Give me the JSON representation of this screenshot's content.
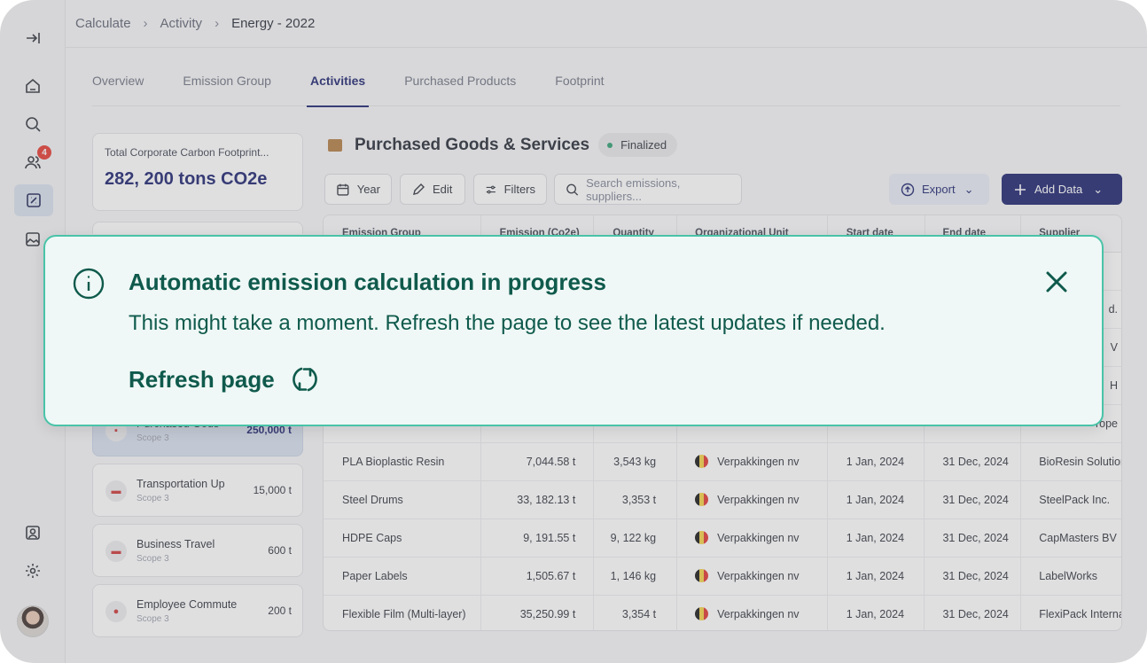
{
  "breadcrumb": {
    "items": [
      "Calculate",
      "Activity"
    ],
    "current": "Energy - 2022"
  },
  "sidebar": {
    "notification_count": "4"
  },
  "tabs": [
    "Overview",
    "Emission Group",
    "Activities",
    "Purchased Products",
    "Footprint"
  ],
  "total": {
    "label": "Total Corporate Carbon Footprint...",
    "value": "282, 200 tons CO2e"
  },
  "categories": [
    {
      "name": "Purchased Gods",
      "scope": "Scope 3",
      "value": "250,000 t"
    },
    {
      "name": "Transportation Up",
      "scope": "Scope 3",
      "value": "15,000 t"
    },
    {
      "name": "Business Travel",
      "scope": "Scope 3",
      "value": "600 t"
    },
    {
      "name": "Employee Commute",
      "scope": "Scope 3",
      "value": "200 t"
    }
  ],
  "content": {
    "title": "Purchased Goods & Services",
    "status": "Finalized"
  },
  "toolbar": {
    "year": "Year",
    "edit": "Edit",
    "filters": "Filters",
    "search_placeholder": "Search emissions, suppliers...",
    "export": "Export",
    "add": "Add Data"
  },
  "table": {
    "headers": [
      "Emission Group",
      "Emission (Co2e)",
      "Quantity",
      "Organizational Unit",
      "Start date",
      "End date",
      "Supplier"
    ],
    "rows": [
      [
        "PLA Bioplastic Resin",
        "7,044.58 t",
        "3,543 kg",
        "Verpakkingen nv",
        "1 Jan, 2024",
        "31 Dec, 2024",
        "BioResin Solutions"
      ],
      [
        "Steel Drums",
        "33, 182.13 t",
        "3,353 t",
        "Verpakkingen nv",
        "1 Jan, 2024",
        "31 Dec, 2024",
        "SteelPack Inc."
      ],
      [
        "HDPE Caps",
        "9, 191.55 t",
        "9, 122 kg",
        "Verpakkingen nv",
        "1 Jan, 2024",
        "31 Dec, 2024",
        "CapMasters BV"
      ],
      [
        "Paper Labels",
        "1,505.67 t",
        "1, 146 kg",
        "Verpakkingen nv",
        "1 Jan, 2024",
        "31 Dec, 2024",
        "LabelWorks"
      ],
      [
        "Flexible Film (Multi-layer)",
        "35,250.99 t",
        "3,354 t",
        "Verpakkingen nv",
        "1 Jan, 2024",
        "31 Dec, 2024",
        "FlexiPack International"
      ]
    ],
    "partial_suppliers": [
      "d.",
      "V",
      "H",
      "rope"
    ]
  },
  "alert": {
    "title": "Automatic emission calculation in progress",
    "text": "This might take a moment. Refresh the page to see the latest updates if needed.",
    "action": "Refresh page"
  },
  "colors": {
    "brand": "#171e6b",
    "alert_border": "#49c3a8",
    "alert_text": "#0f5a4c",
    "alert_bg": "#eff8f6"
  }
}
